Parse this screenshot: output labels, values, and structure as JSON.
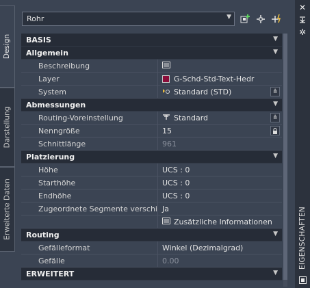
{
  "tabs": [
    {
      "label": "Design"
    },
    {
      "label": "Darstellung"
    },
    {
      "label": "Erweiterte Daten"
    }
  ],
  "style_select": {
    "value": "Rohr"
  },
  "sections": {
    "basis": {
      "label": "BASIS"
    },
    "allgemein": {
      "label": "Allgemein",
      "rows": [
        {
          "label": "Beschreibung",
          "value": ""
        },
        {
          "label": "Layer",
          "value": "G-Schd-Std-Text-Hedr",
          "color": "#8b0d3a"
        },
        {
          "label": "System",
          "value": "Standard (STD)"
        }
      ]
    },
    "abmessungen": {
      "label": "Abmessungen",
      "rows": [
        {
          "label": "Routing-Voreinstellung",
          "value": "Standard"
        },
        {
          "label": "Nenngröße",
          "value": "15"
        },
        {
          "label": "Schnittlänge",
          "value": "961"
        }
      ]
    },
    "platzierung": {
      "label": "Platzierung",
      "rows": [
        {
          "label": "Höhe",
          "value": "UCS : 0"
        },
        {
          "label": "Starthöhe",
          "value": "UCS : 0"
        },
        {
          "label": "Endhöhe",
          "value": "UCS : 0"
        },
        {
          "label": "Zugeordnete Segmente verschi...",
          "value": "Ja"
        },
        {
          "label": "",
          "value": "Zusätzliche Informationen"
        }
      ]
    },
    "routing": {
      "label": "Routing",
      "rows": [
        {
          "label": "Gefälleformat",
          "value": "Winkel (Dezimalgrad)"
        },
        {
          "label": "Gefälle",
          "value": "0.00"
        }
      ]
    },
    "erweitert": {
      "label": "ERWEITERT"
    }
  },
  "palette_title": "EIGENSCHAFTEN",
  "colors": {
    "panel": "#3b4453",
    "category": "#262c37",
    "layer_swatch": "#8b0d3a"
  }
}
